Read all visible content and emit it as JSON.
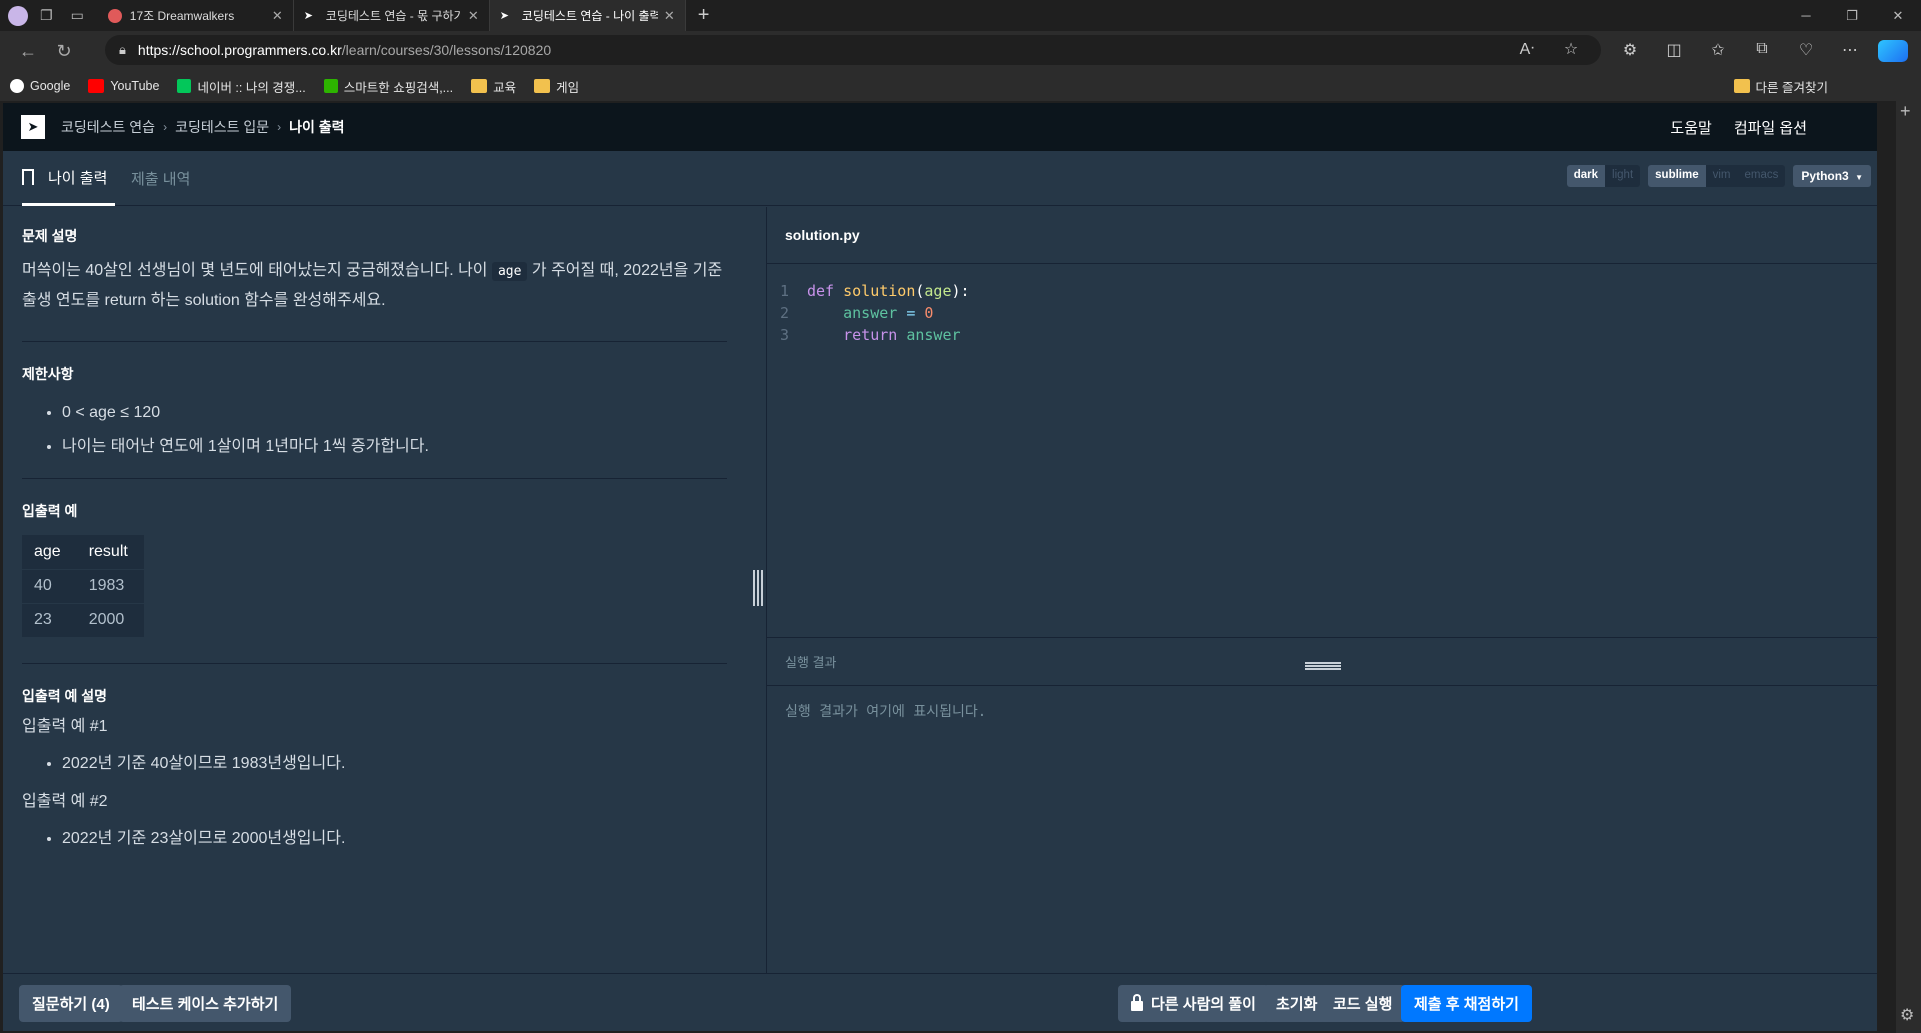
{
  "browser": {
    "tabs": [
      {
        "title": "17조 Dreamwalkers"
      },
      {
        "title": "코딩테스트 연습 - 몫 구하기 | 프"
      },
      {
        "title": "코딩테스트 연습 - 나이 출력 | 프"
      }
    ],
    "url_host": "https://school.programmers.co.kr",
    "url_path": "/learn/courses/30/lessons/120820",
    "bookmarks": [
      "Google",
      "YouTube",
      "네이버 :: 나의 경쟁...",
      "스마트한 쇼핑검색,...",
      "교육",
      "게임"
    ],
    "other_favorites": "다른 즐겨찾기"
  },
  "nav": {
    "crumb1": "코딩테스트 연습",
    "crumb2": "코딩테스트 입문",
    "crumb3": "나이 출력",
    "help": "도움말",
    "compile_options": "컴파일 옵션"
  },
  "problem_tabs": {
    "active": "나이 출력",
    "history": "제출 내역"
  },
  "editor_options": {
    "themes": [
      "dark",
      "light"
    ],
    "keymaps": [
      "sublime",
      "vim",
      "emacs"
    ],
    "language": "Python3"
  },
  "problem": {
    "desc_title": "문제 설명",
    "desc_part1": "머쓱이는 40살인 선생님이 몇 년도에 태어났는지 궁금해졌습니다. 나이 ",
    "desc_code": "age",
    "desc_part2": " 가 주어질 때, 2022년을 기준 출생 연도를 return 하는 solution 함수를 완성해주세요.",
    "constraints_title": "제한사항",
    "constraints": [
      "0 < age ≤ 120",
      "나이는 태어난 연도에 1살이며 1년마다 1씩 증가합니다."
    ],
    "io_title": "입출력 예",
    "io_headers": [
      "age",
      "result"
    ],
    "io_rows": [
      [
        "40",
        "1983"
      ],
      [
        "23",
        "2000"
      ]
    ],
    "io_explain_title": "입출력 예 설명",
    "example1_title": "입출력 예 #1",
    "example1": "2022년 기준 40살이므로 1983년생입니다.",
    "example2_title": "입출력 예 #2",
    "example2": "2022년 기준 23살이므로 2000년생입니다."
  },
  "editor": {
    "filename": "solution.py",
    "line_numbers": [
      "1",
      "2",
      "3"
    ],
    "code": {
      "kw_def": "def",
      "fn_name": "solution",
      "open": "(",
      "param": "age",
      "close": "):",
      "var_answer": "answer",
      "eq": " = ",
      "zero": "0",
      "kw_return": "return",
      "ret_var": "answer"
    },
    "result_title": "실행 결과",
    "result_placeholder": "실행 결과가 여기에 표시됩니다."
  },
  "buttons": {
    "ask": "질문하기 (4)",
    "add_testcase": "테스트 케이스 추가하기",
    "others_solution": "다른 사람의 풀이",
    "reset": "초기화",
    "run": "코드 실행",
    "submit": "제출 후 채점하기"
  },
  "colors": {
    "primary": "#0078ff",
    "panel": "#263747",
    "nav": "#0c151c"
  }
}
